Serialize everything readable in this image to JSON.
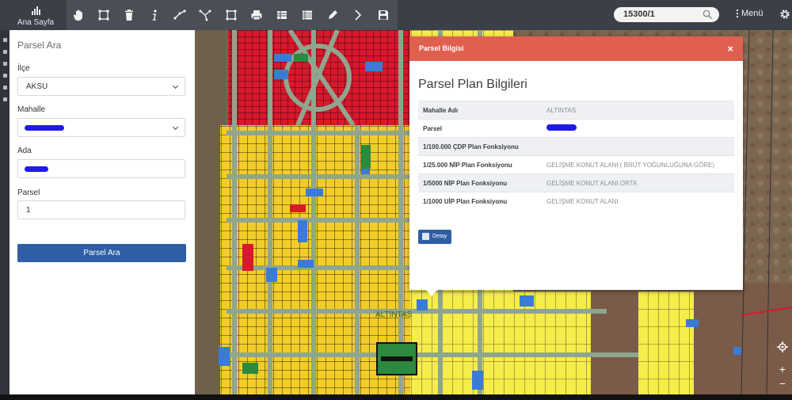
{
  "toolbar": {
    "home_label": "Ana Sayfa",
    "tools": [
      "hand-icon",
      "select-extent-icon",
      "trash-icon",
      "info-icon",
      "measure-line-icon",
      "measure-angle-icon",
      "measure-area-icon",
      "print-icon",
      "table-icon",
      "list-icon",
      "pencil-icon",
      "arrow-right-icon",
      "save-icon"
    ]
  },
  "search": {
    "value": "15300/1"
  },
  "menu": {
    "label": "Menü"
  },
  "panel": {
    "title": "Parsel Ara",
    "ilce_label": "İlçe",
    "ilce_value": "AKSU",
    "mahalle_label": "Mahalle",
    "ada_label": "Ada",
    "parsel_label": "Parsel",
    "parsel_value": "1",
    "button_label": "Parsel Ara"
  },
  "dialog": {
    "header": "Parsel Bilgisi",
    "close": "×",
    "title": "Parsel Plan Bilgileri",
    "rows": [
      {
        "key": "Mahalle Adı",
        "value": "ALTINTAS"
      },
      {
        "key": "Parsel",
        "value": ""
      },
      {
        "key": "1/100.000 ÇDP Plan Fonksiyonu",
        "value": ""
      },
      {
        "key": "1/25.000 NİP Plan Fonksiyonu",
        "value": "GELİŞME KONUT ALANI ( BRÜT YOĞUNLUĞUNA GÖRE)"
      },
      {
        "key": "1/5000 NİP Plan Fonksiyonu",
        "value": "GELİŞME KONUT ALANI ORTA"
      },
      {
        "key": "1/1000 UİP Plan Fonksiyonu",
        "value": "GELİŞME KONUT ALANI"
      }
    ],
    "detail_button": "Detay"
  },
  "map": {
    "label": "ALTINTAS"
  },
  "colors": {
    "residential": "#f2cd2a",
    "residential_light": "#f6ec4a",
    "commercial": "#d8182c",
    "roads": "#8fa58d",
    "dialog_header": "#e06050",
    "button": "#2f5ea5"
  }
}
